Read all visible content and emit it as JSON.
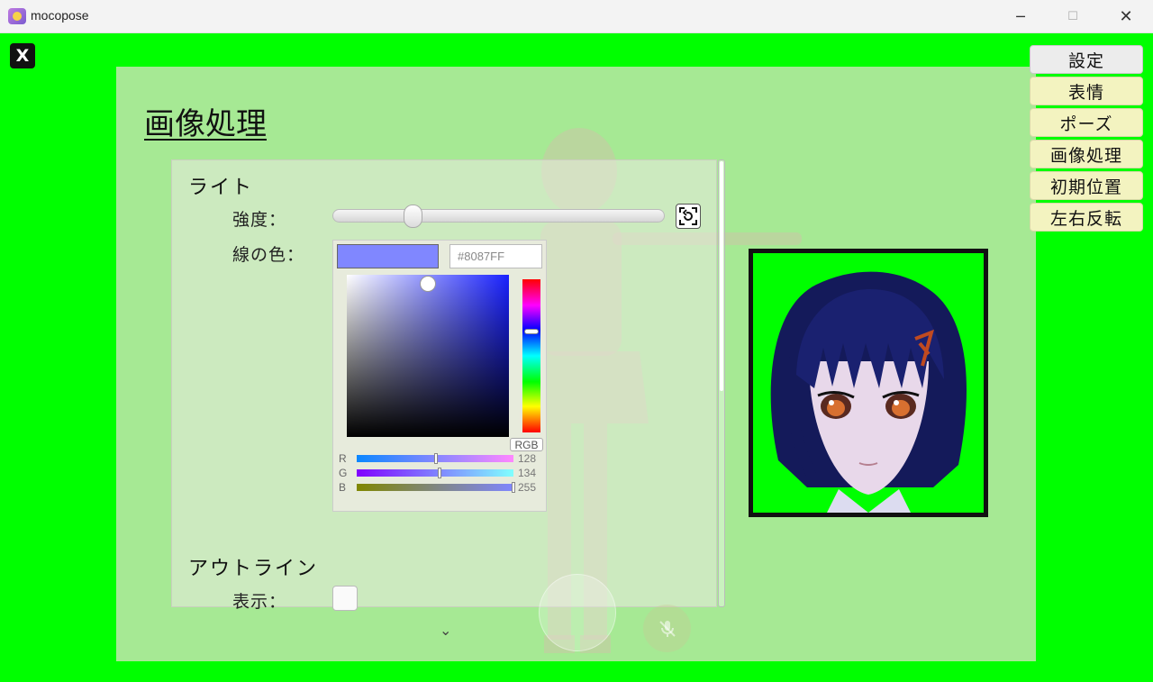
{
  "window": {
    "title": "mocopose",
    "minimize_glyph": "─",
    "maximize_glyph": "☐",
    "close_glyph": "✕"
  },
  "close_overlay": {
    "label": "X"
  },
  "panel": {
    "title": "画像処理",
    "light": {
      "heading": "ライト",
      "intensity_label": "強度：",
      "intensity_value": 0.24,
      "line_color_label": "線の色：",
      "color_hex": "#8087FF",
      "color_mode_button": "RGB",
      "channels": [
        {
          "name": "R",
          "value": "128"
        },
        {
          "name": "G",
          "value": "134"
        },
        {
          "name": "B",
          "value": "255"
        }
      ]
    },
    "outline": {
      "heading": "アウトライン",
      "show_label": "表示：",
      "show_checked": false
    },
    "scroll_more_glyph": "⌄"
  },
  "side_menu": {
    "items": [
      {
        "label": "設定",
        "active": true
      },
      {
        "label": "表情",
        "active": false
      },
      {
        "label": "ポーズ",
        "active": false
      },
      {
        "label": "画像処理",
        "active": false
      },
      {
        "label": "初期位置",
        "active": false
      },
      {
        "label": "左右反転",
        "active": false
      }
    ]
  },
  "colors": {
    "background": "#00ff00",
    "swatch": "#8087FF",
    "menu_button": "#f3f3c0"
  },
  "icons": [
    "app-icon",
    "reset-icon",
    "mic-off-icon",
    "chevron-down-icon"
  ]
}
